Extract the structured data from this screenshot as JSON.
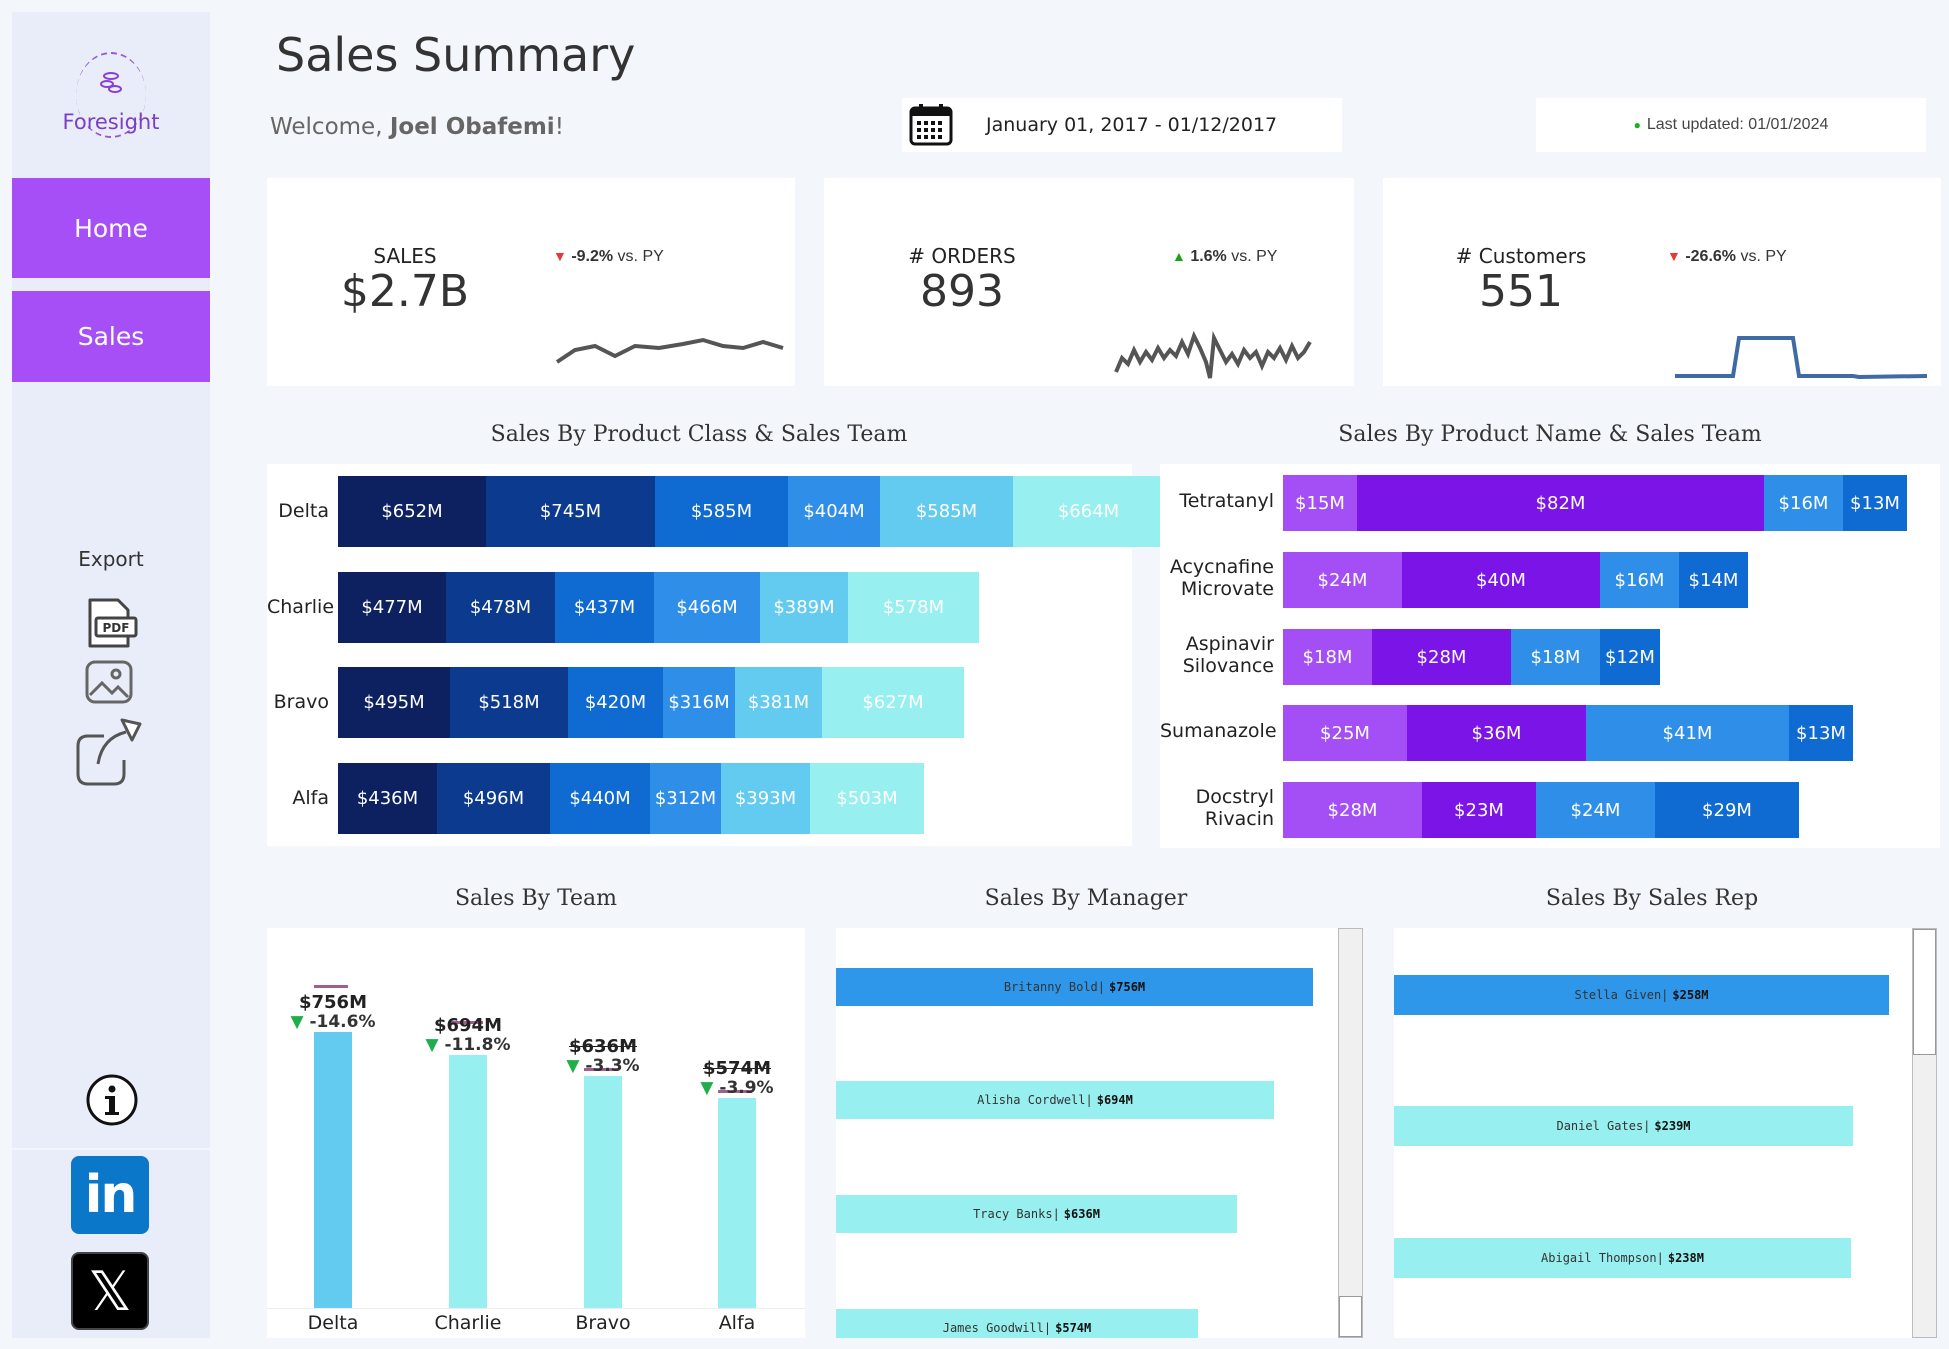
{
  "sidebar": {
    "logo_text": "Foresight",
    "nav": [
      {
        "label": "Home"
      },
      {
        "label": "Sales"
      }
    ],
    "export_label": "Export",
    "pdf_label": "PDF",
    "social_linkedin": "in",
    "social_x": "𝕏"
  },
  "header": {
    "title": "Sales Summary",
    "welcome_prefix": "Welcome, ",
    "user_name": "Joel Obafemi",
    "welcome_suffix": "!",
    "date_range": "January 01, 2017 - 01/12/2017",
    "last_updated": "Last updated: 01/01/2024"
  },
  "colors": {
    "accent": "#a64ff7",
    "navy": "#0d2160",
    "blue_dark": "#0b3a8f",
    "blue": "#0f6ad1",
    "blue_mid": "#2f8fe8",
    "blue_light": "#63cbef",
    "cyan": "#97f0ef",
    "purple_light": "#a44ff5",
    "purple": "#7b14e6",
    "down": "#e53935",
    "up": "#1aa31a"
  },
  "kpis": [
    {
      "label": "SALES",
      "value": "$2.7B",
      "delta": "-9.2%",
      "delta_suffix": " vs. PY",
      "direction": "down",
      "arrow": "▼"
    },
    {
      "label": "# ORDERS",
      "value": "893",
      "delta": "1.6%",
      "delta_suffix": " vs. PY",
      "direction": "up",
      "arrow": "▲"
    },
    {
      "label": "# Customers",
      "value": "551",
      "delta": "-26.6%",
      "delta_suffix": " vs. PY",
      "direction": "down",
      "arrow": "▼"
    }
  ],
  "class_chart": {
    "title": "Sales By Product Class & Sales Team",
    "rows": [
      {
        "team": "Delta",
        "segments": [
          "$652M",
          "$745M",
          "$585M",
          "$404M",
          "$585M",
          "$664M"
        ],
        "values": [
          652,
          745,
          585,
          404,
          585,
          664
        ]
      },
      {
        "team": "Charlie",
        "segments": [
          "$477M",
          "$478M",
          "$437M",
          "$466M",
          "$389M",
          "$578M"
        ],
        "values": [
          477,
          478,
          437,
          466,
          389,
          578
        ]
      },
      {
        "team": "Bravo",
        "segments": [
          "$495M",
          "$518M",
          "$420M",
          "$316M",
          "$381M",
          "$627M"
        ],
        "values": [
          495,
          518,
          420,
          316,
          381,
          627
        ]
      },
      {
        "team": "Alfa",
        "segments": [
          "$436M",
          "$496M",
          "$440M",
          "$312M",
          "$393M",
          "$503M"
        ],
        "values": [
          436,
          496,
          440,
          312,
          393,
          503
        ]
      }
    ]
  },
  "product_chart": {
    "title": "Sales By Product Name & Sales Team",
    "rows": [
      {
        "name": [
          "Tetratanyl"
        ],
        "segments": [
          "$15M",
          "$82M",
          "$16M",
          "$13M"
        ],
        "values": [
          15,
          82,
          16,
          13
        ]
      },
      {
        "name": [
          "Acycnafine",
          "Microvate"
        ],
        "segments": [
          "$24M",
          "$40M",
          "$16M",
          "$14M"
        ],
        "values": [
          24,
          40,
          16,
          14
        ]
      },
      {
        "name": [
          "Aspinavir",
          "Silovance"
        ],
        "segments": [
          "$18M",
          "$28M",
          "$18M",
          "$12M"
        ],
        "values": [
          18,
          28,
          18,
          12
        ]
      },
      {
        "name": [
          "Sumanazole"
        ],
        "segments": [
          "$25M",
          "$36M",
          "$41M",
          "$13M"
        ],
        "values": [
          25,
          36,
          41,
          13
        ]
      },
      {
        "name": [
          "Docstryl",
          "Rivacin"
        ],
        "segments": [
          "$28M",
          "$23M",
          "$24M",
          "$29M"
        ],
        "values": [
          28,
          23,
          24,
          29
        ]
      }
    ]
  },
  "team_chart": {
    "title": "Sales By Team",
    "bars": [
      {
        "team": "Delta",
        "value_label": "$756M",
        "pct": "-14.6%",
        "value": 756,
        "target_value": 885,
        "struck": false,
        "arrow": "▼"
      },
      {
        "team": "Charlie",
        "value_label": "$694M",
        "pct": "-11.8%",
        "value": 694,
        "target_value": 787,
        "struck": false,
        "arrow": "▼"
      },
      {
        "team": "Bravo",
        "value_label": "$636M",
        "pct": "-3.3%",
        "value": 636,
        "target_value": 658,
        "struck": true,
        "arrow": "▼"
      },
      {
        "team": "Alfa",
        "value_label": "$574M",
        "pct": "-3.9%",
        "value": 574,
        "target_value": 597,
        "struck": true,
        "arrow": "▼"
      }
    ]
  },
  "manager_chart": {
    "title": "Sales By Manager",
    "items": [
      {
        "name": "Britanny Bold",
        "value": "$756M",
        "amount": 756,
        "color": "#2f97ea"
      },
      {
        "name": "Alisha Cordwell",
        "value": "$694M",
        "amount": 694,
        "color": "#97f0ef"
      },
      {
        "name": "Tracy Banks",
        "value": "$636M",
        "amount": 636,
        "color": "#97f0ef"
      },
      {
        "name": "James Goodwill",
        "value": "$574M",
        "amount": 574,
        "color": "#97f0ef"
      }
    ]
  },
  "rep_chart": {
    "title": "Sales By Sales Rep",
    "items": [
      {
        "name": "Stella Given",
        "value": "$258M",
        "amount": 258,
        "color": "#2f97ea"
      },
      {
        "name": "Daniel Gates",
        "value": "$239M",
        "amount": 239,
        "color": "#97f0ef"
      },
      {
        "name": "Abigail Thompson",
        "value": "$238M",
        "amount": 238,
        "color": "#97f0ef"
      }
    ]
  },
  "chart_data": [
    {
      "type": "bar",
      "title": "Sales By Product Class & Sales Team",
      "categories": [
        "Delta",
        "Charlie",
        "Bravo",
        "Alfa"
      ],
      "series": [
        {
          "values": [
            652,
            477,
            495,
            436
          ]
        },
        {
          "values": [
            745,
            478,
            518,
            496
          ]
        },
        {
          "values": [
            585,
            437,
            420,
            440
          ]
        },
        {
          "values": [
            404,
            466,
            316,
            312
          ]
        },
        {
          "values": [
            585,
            389,
            381,
            393
          ]
        },
        {
          "values": [
            664,
            578,
            627,
            503
          ]
        }
      ]
    },
    {
      "type": "bar",
      "title": "Sales By Product Name & Sales Team",
      "categories": [
        "Tetratanyl",
        "Acycnafine Microvate",
        "Aspinavir Silovance",
        "Sumanazole",
        "Docstryl Rivacin"
      ],
      "series": [
        {
          "values": [
            15,
            24,
            18,
            25,
            28
          ]
        },
        {
          "values": [
            82,
            40,
            28,
            36,
            23
          ]
        },
        {
          "values": [
            16,
            16,
            18,
            41,
            24
          ]
        },
        {
          "values": [
            13,
            14,
            12,
            13,
            29
          ]
        }
      ]
    },
    {
      "type": "bar",
      "title": "Sales By Team",
      "categories": [
        "Delta",
        "Charlie",
        "Bravo",
        "Alfa"
      ],
      "values": [
        756,
        694,
        636,
        574
      ]
    },
    {
      "type": "bar",
      "title": "Sales By Manager",
      "categories": [
        "Britanny Bold",
        "Alisha Cordwell",
        "Tracy Banks",
        "James Goodwill"
      ],
      "values": [
        756,
        694,
        636,
        574
      ]
    },
    {
      "type": "bar",
      "title": "Sales By Sales Rep",
      "categories": [
        "Stella Given",
        "Daniel Gates",
        "Abigail Thompson"
      ],
      "values": [
        258,
        239,
        238
      ]
    }
  ]
}
